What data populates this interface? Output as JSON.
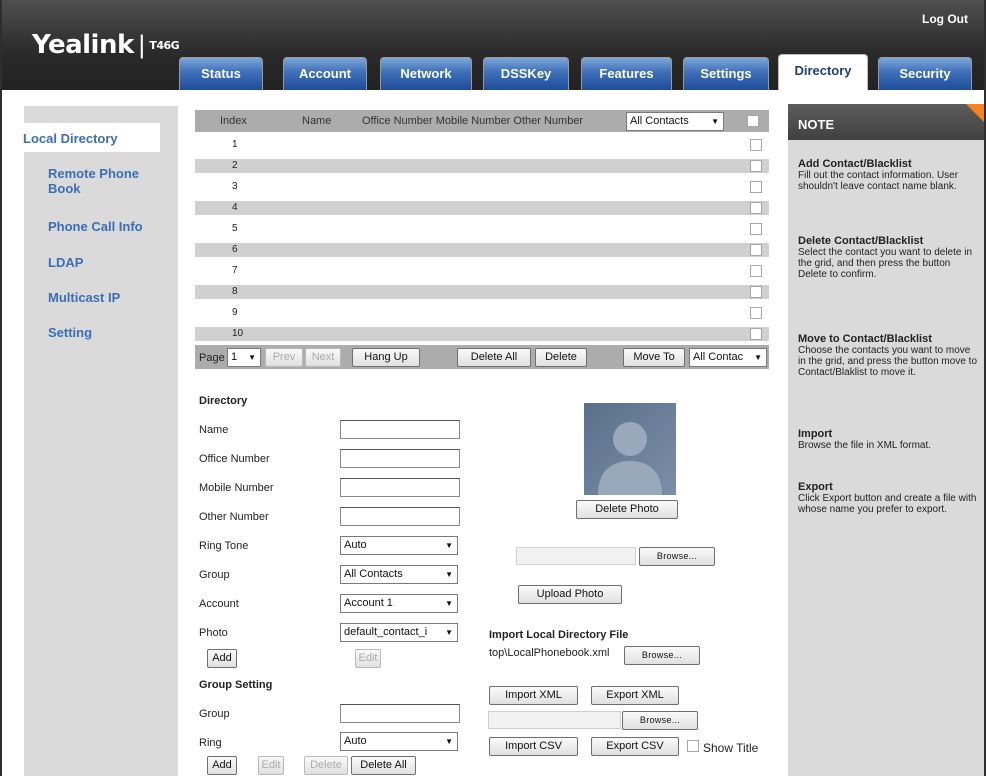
{
  "header": {
    "brand": "Yealink",
    "separator": "|",
    "model": "T46G",
    "logout": "Log Out"
  },
  "tabs": [
    {
      "label": "Status"
    },
    {
      "label": "Account"
    },
    {
      "label": "Network"
    },
    {
      "label": "DSSKey"
    },
    {
      "label": "Features"
    },
    {
      "label": "Settings"
    },
    {
      "label": "Directory"
    },
    {
      "label": "Security"
    }
  ],
  "sidebar": {
    "items": [
      {
        "label": "Local Directory"
      },
      {
        "label": "Remote Phone Book"
      },
      {
        "label": "Phone Call Info"
      },
      {
        "label": "LDAP"
      },
      {
        "label": "Multicast IP"
      },
      {
        "label": "Setting"
      }
    ]
  },
  "grid": {
    "headers": {
      "index": "Index",
      "name": "Name",
      "numbers": "Office Number Mobile Number Other Number",
      "filter": "All Contacts"
    },
    "rows": [
      "1",
      "2",
      "3",
      "4",
      "5",
      "6",
      "7",
      "8",
      "9",
      "10"
    ]
  },
  "pager": {
    "page_label": "Page",
    "page_value": "1",
    "prev": "Prev",
    "next": "Next",
    "hang_up": "Hang Up",
    "delete_all": "Delete All",
    "delete": "Delete",
    "move_to": "Move To",
    "move_target": "All Contac"
  },
  "directory_form": {
    "title": "Directory",
    "name_label": "Name",
    "office_label": "Office Number",
    "mobile_label": "Mobile Number",
    "other_label": "Other Number",
    "ring_label": "Ring Tone",
    "ring_value": "Auto",
    "group_label": "Group",
    "group_value": "All Contacts",
    "account_label": "Account",
    "account_value": "Account 1",
    "photo_label": "Photo",
    "photo_value": "default_contact_i",
    "add": "Add",
    "edit": "Edit"
  },
  "photo_panel": {
    "delete_photo": "Delete Photo",
    "browse": "Browse...",
    "upload_photo": "Upload Photo"
  },
  "import_panel": {
    "title": "Import Local Directory File",
    "file_path": "top\\LocalPhonebook.xml",
    "browse": "Browse...",
    "import_xml": "Import XML",
    "export_xml": "Export XML",
    "browse2": "Browse...",
    "import_csv": "Import CSV",
    "export_csv": "Export CSV",
    "show_title": "Show Title"
  },
  "group_setting": {
    "title": "Group Setting",
    "group_label": "Group",
    "ring_label": "Ring",
    "ring_value": "Auto",
    "add": "Add",
    "edit": "Edit",
    "delete": "Delete",
    "delete_all": "Delete All"
  },
  "note": {
    "title": "NOTE",
    "sections": [
      {
        "title": "Add Contact/Blacklist",
        "text": "Fill out the contact information. User shouldn't leave contact name blank."
      },
      {
        "title": "Delete Contact/Blacklist",
        "text": "Select the contact you want to delete in the grid, and then press the button Delete to confirm."
      },
      {
        "title": "Move to Contact/Blacklist",
        "text": "Choose the contacts you want to move in the grid, and press the button move to Contact/Blaklist to move it."
      },
      {
        "title": "Import",
        "text": "Browse the file in XML format."
      },
      {
        "title": "Export",
        "text": "Click Export button and create a file with whose name you prefer to export."
      }
    ]
  }
}
